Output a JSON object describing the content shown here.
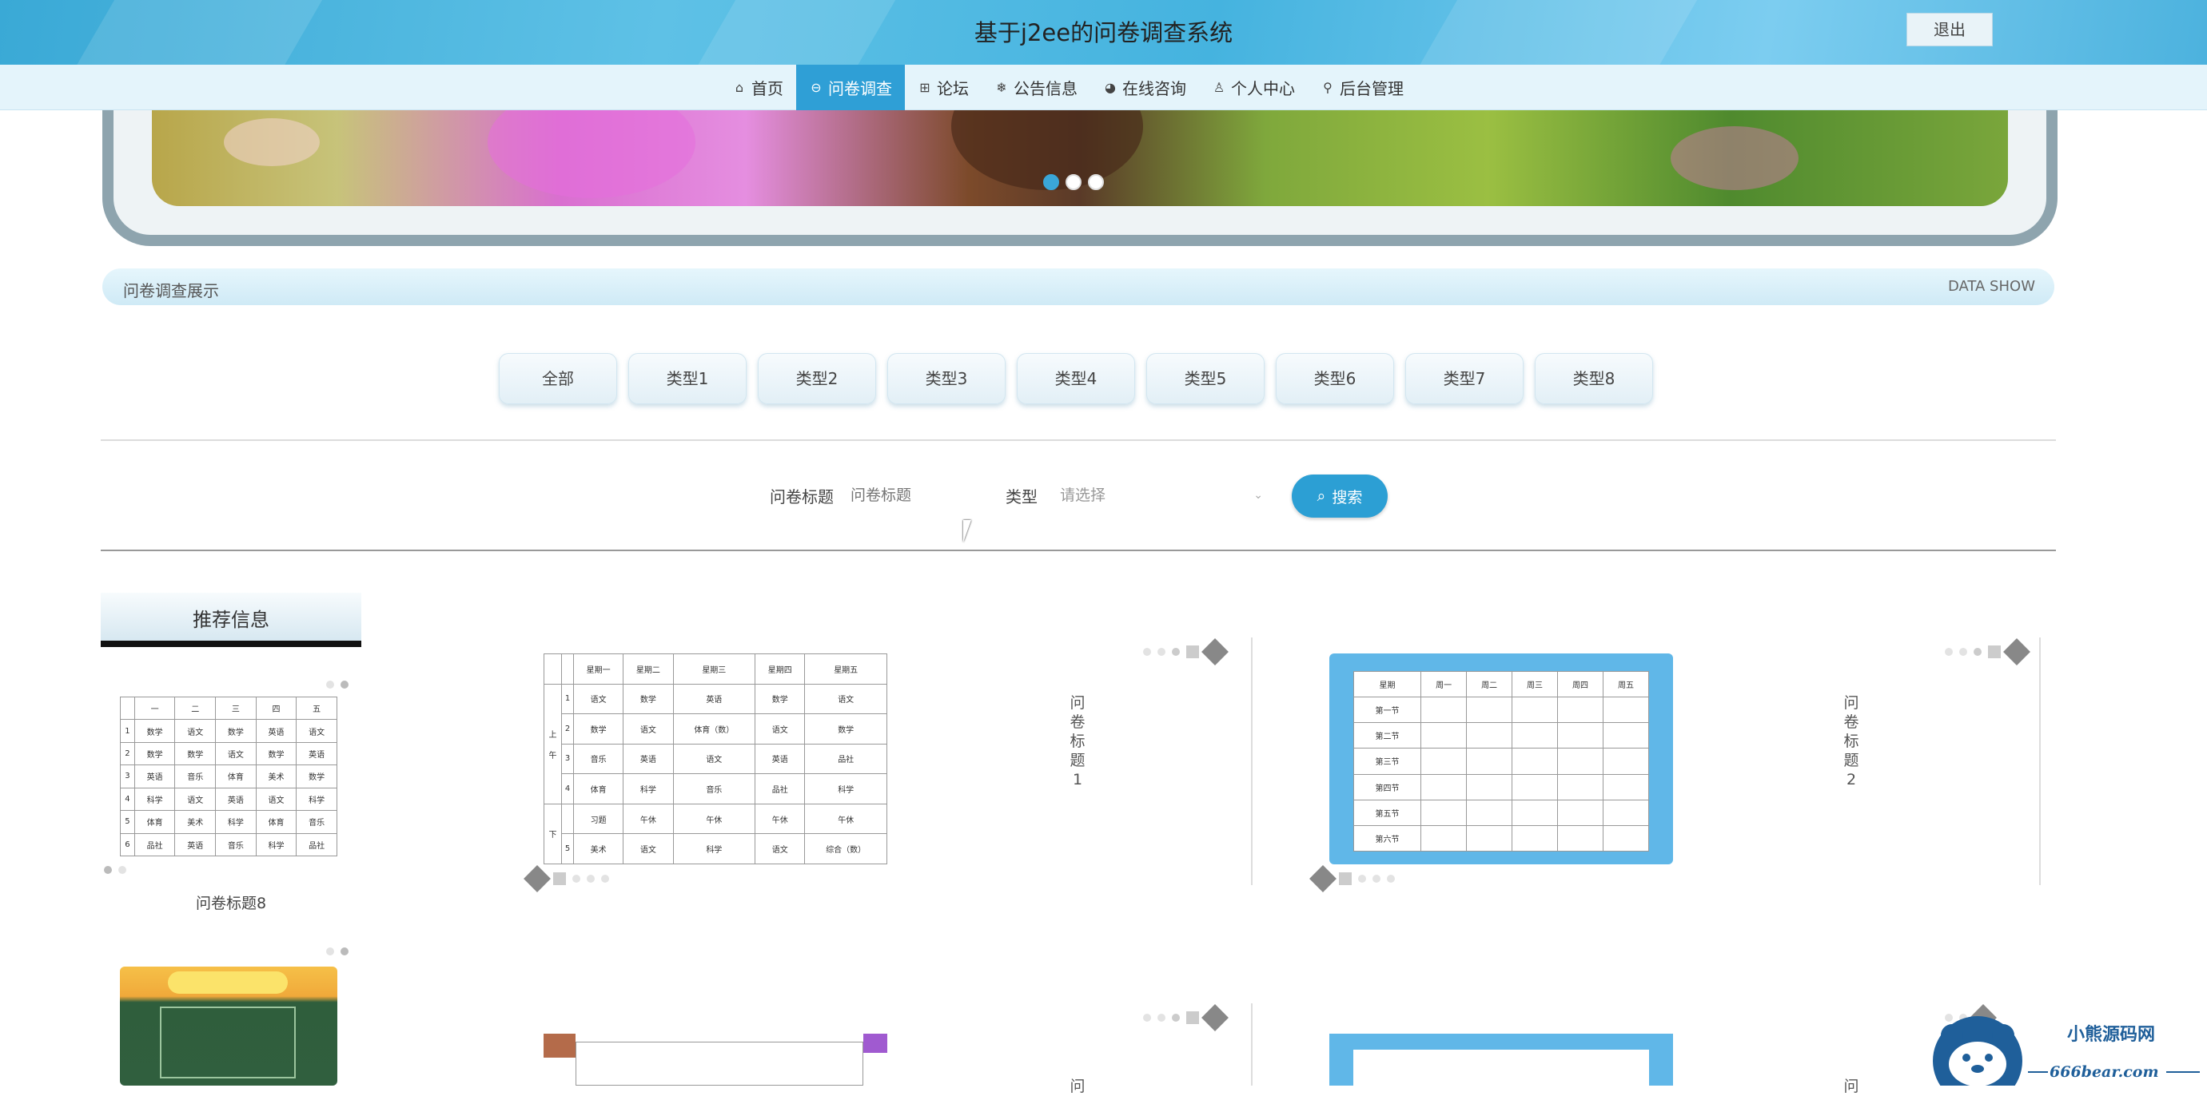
{
  "header": {
    "title": "基于j2ee的问卷调查系统",
    "logout_label": "退出"
  },
  "nav": {
    "items": [
      {
        "label": "首页",
        "icon": "home-icon",
        "glyph": "⌂"
      },
      {
        "label": "问卷调查",
        "icon": "survey-icon",
        "glyph": "⊖"
      },
      {
        "label": "论坛",
        "icon": "forum-icon",
        "glyph": "⊞"
      },
      {
        "label": "公告信息",
        "icon": "snowflake-icon",
        "glyph": "❄"
      },
      {
        "label": "在线咨询",
        "icon": "chat-icon",
        "glyph": "◕"
      },
      {
        "label": "个人中心",
        "icon": "user-icon",
        "glyph": "♙"
      },
      {
        "label": "后台管理",
        "icon": "link-icon",
        "glyph": "⚲"
      }
    ],
    "active_index": 1
  },
  "banner": {
    "slide_count": 3,
    "active_slide": 1
  },
  "section": {
    "title": "问卷调查展示",
    "subtitle": "DATA SHOW"
  },
  "categories": [
    "全部",
    "类型1",
    "类型2",
    "类型3",
    "类型4",
    "类型5",
    "类型6",
    "类型7",
    "类型8"
  ],
  "search": {
    "title_label": "问卷标题",
    "title_placeholder": "问卷标题",
    "type_label": "类型",
    "type_placeholder": "请选择",
    "button_label": "搜索"
  },
  "recommend": {
    "heading": "推荐信息",
    "items": [
      {
        "name": "问卷标题8"
      },
      {
        "name": ""
      }
    ]
  },
  "cards": [
    {
      "title": "问卷标题1"
    },
    {
      "title": "问卷标题2"
    },
    {
      "title": "问"
    },
    {
      "title": "问"
    }
  ],
  "watermark": {
    "brand": "小熊源码网",
    "url": "666bear.com"
  },
  "colors": {
    "accent": "#2f9fd6",
    "header_gradient": "#45b3df",
    "nav_bg": "#e4f4fb"
  }
}
